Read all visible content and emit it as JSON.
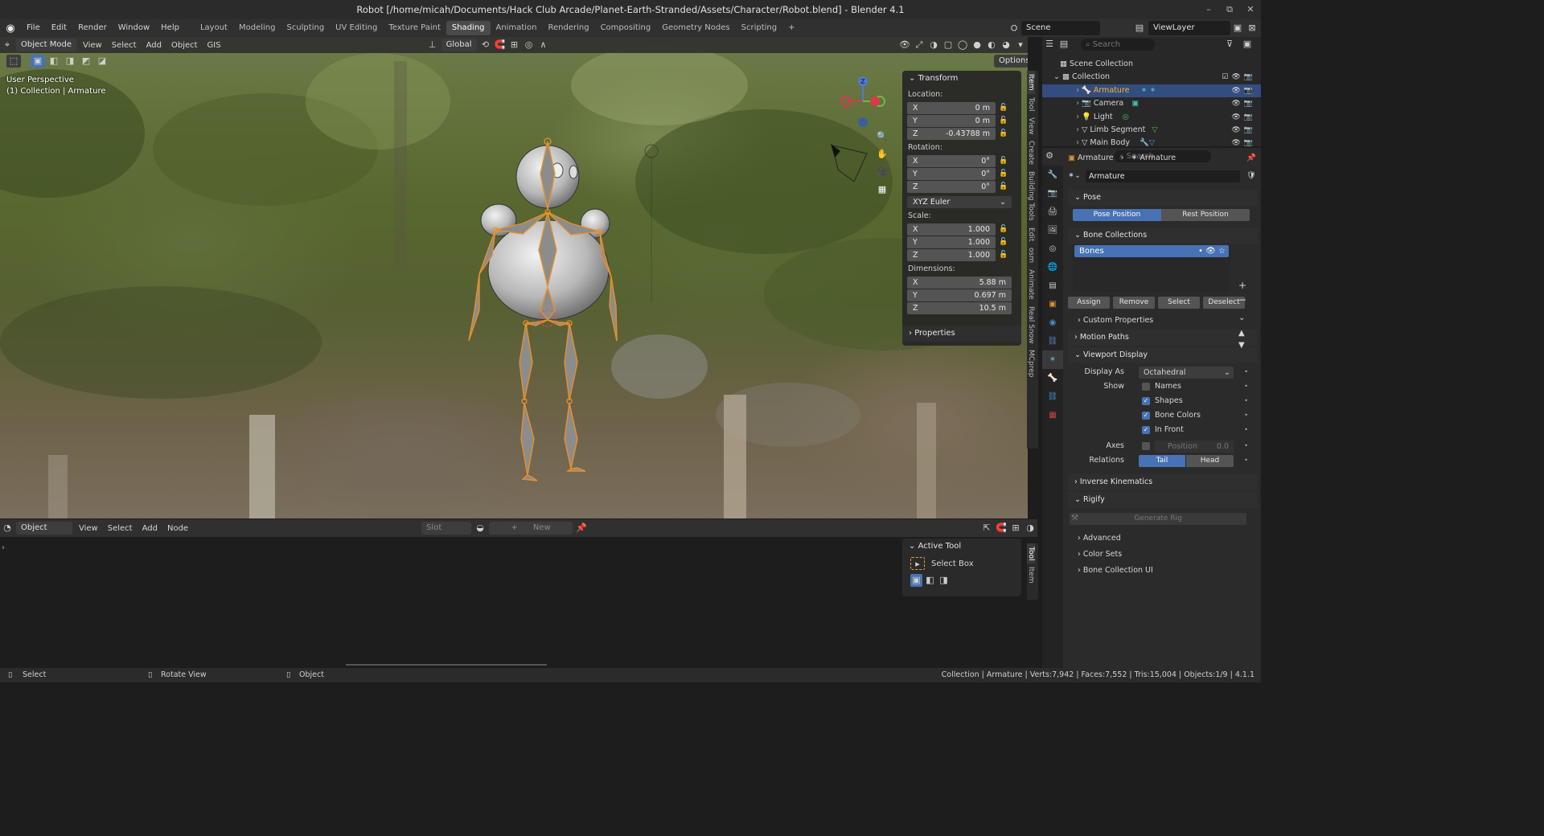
{
  "title": "Robot [/home/micah/Documents/Hack Club Arcade/Planet-Earth-Stranded/Assets/Character/Robot.blend] - Blender 4.1",
  "menus": [
    "File",
    "Edit",
    "Render",
    "Window",
    "Help"
  ],
  "workspaces": [
    "Layout",
    "Modeling",
    "Sculpting",
    "UV Editing",
    "Texture Paint",
    "Shading",
    "Animation",
    "Rendering",
    "Compositing",
    "Geometry Nodes",
    "Scripting"
  ],
  "active_workspace": "Shading",
  "scene": "Scene",
  "view_layer": "ViewLayer",
  "viewport": {
    "mode": "Object Mode",
    "menus": [
      "View",
      "Select",
      "Add",
      "Object",
      "GIS"
    ],
    "transform_orientation": "Global",
    "options": "Options",
    "perspective": "User Perspective",
    "collection_info": "(1) Collection | Armature"
  },
  "npanel": {
    "title": "Transform",
    "location_label": "Location:",
    "location": [
      {
        "axis": "X",
        "val": "0 m"
      },
      {
        "axis": "Y",
        "val": "0 m"
      },
      {
        "axis": "Z",
        "val": "-0.43788 m"
      }
    ],
    "rotation_label": "Rotation:",
    "rotation": [
      {
        "axis": "X",
        "val": "0°"
      },
      {
        "axis": "Y",
        "val": "0°"
      },
      {
        "axis": "Z",
        "val": "0°"
      }
    ],
    "rotation_mode": "XYZ Euler",
    "scale_label": "Scale:",
    "scale": [
      {
        "axis": "X",
        "val": "1.000"
      },
      {
        "axis": "Y",
        "val": "1.000"
      },
      {
        "axis": "Z",
        "val": "1.000"
      }
    ],
    "dimensions_label": "Dimensions:",
    "dimensions": [
      {
        "axis": "X",
        "val": "5.88 m"
      },
      {
        "axis": "Y",
        "val": "0.697 m"
      },
      {
        "axis": "Z",
        "val": "10.5 m"
      }
    ],
    "properties": "Properties"
  },
  "side_tabs": [
    "Item",
    "Tool",
    "View",
    "Create",
    "Building Tools",
    "Edit",
    "osm",
    "Animate",
    "Real Snow",
    "MCprep"
  ],
  "shader": {
    "mode": "Object",
    "menus": [
      "View",
      "Select",
      "Add",
      "Node"
    ],
    "slot": "Slot",
    "new": "New",
    "active_tool_title": "Active Tool",
    "active_tool": "Select Box",
    "tabs": [
      "Tool",
      "Item"
    ]
  },
  "status": {
    "select": "Select",
    "rotate": "Rotate View",
    "object": "Object",
    "info": "Collection | Armature | Verts:7,942 | Faces:7,552 | Tris:15,004 | Objects:1/9 | 4.1.1"
  },
  "outliner": {
    "search": "Search",
    "root": "Scene Collection",
    "collection": "Collection",
    "items": [
      "Armature",
      "Camera",
      "Light",
      "Limb Segment",
      "Main Body"
    ]
  },
  "props": {
    "search": "Search",
    "breadcrumb1": "Armature",
    "breadcrumb2": "Armature",
    "data_name": "Armature",
    "pose": "Pose",
    "pose_position": "Pose Position",
    "rest_position": "Rest Position",
    "bone_collections": "Bone Collections",
    "bones": "Bones",
    "assign": "Assign",
    "remove": "Remove",
    "select": "Select",
    "deselect": "Deselect",
    "custom_properties": "Custom Properties",
    "motion_paths": "Motion Paths",
    "viewport_display": "Viewport Display",
    "display_as_label": "Display As",
    "display_as": "Octahedral",
    "show": "Show",
    "names": "Names",
    "shapes": "Shapes",
    "bone_colors": "Bone Colors",
    "in_front": "In Front",
    "axes": "Axes",
    "position": "Position",
    "position_val": "0.0",
    "relations": "Relations",
    "tail": "Tail",
    "head": "Head",
    "inverse_kinematics": "Inverse Kinematics",
    "rigify": "Rigify",
    "generate_rig": "Generate Rig",
    "advanced": "Advanced",
    "color_sets": "Color Sets",
    "bone_collection_ui": "Bone Collection UI"
  },
  "colors": {
    "accent": "#4772b3",
    "selected_text": "#ffaf29",
    "bone_outline": "#e8902c"
  }
}
